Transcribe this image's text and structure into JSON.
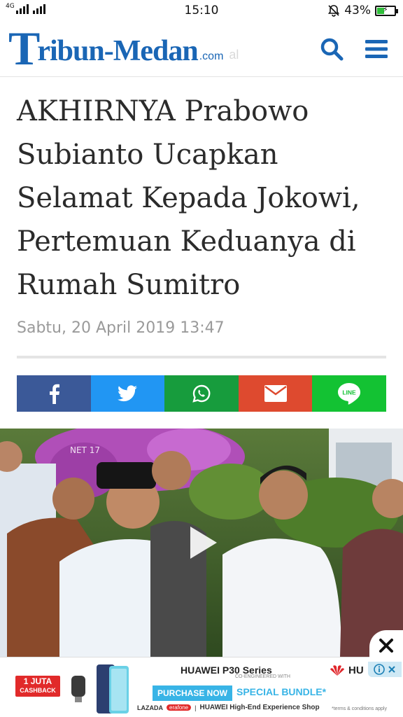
{
  "status_bar": {
    "network": "4G",
    "time": "15:10",
    "battery_percent": "43%",
    "battery_level": 0.43
  },
  "header": {
    "logo_initial": "T",
    "logo_name": "ribun-Medan",
    "logo_suffix": ".com",
    "logo_ghost_text": "al",
    "brand_color": "#1a66b5"
  },
  "article": {
    "headline": "AKHIRNYA Prabowo Subianto Ucapkan Selamat Kepada Jokowi, Pertemuan Keduanya di Rumah Sumitro",
    "date": "Sabtu, 20 April 2019 13:47"
  },
  "share_bar": {
    "buttons": [
      {
        "name": "facebook",
        "icon": "facebook-icon",
        "color": "#3b5998"
      },
      {
        "name": "twitter",
        "icon": "twitter-icon",
        "color": "#2196f3"
      },
      {
        "name": "whatsapp",
        "icon": "whatsapp-icon",
        "color": "#179c3d"
      },
      {
        "name": "email",
        "icon": "email-icon",
        "color": "#de4a2f"
      },
      {
        "name": "line",
        "icon": "line-icon",
        "color": "#13c233",
        "label": "LINE"
      }
    ]
  },
  "media": {
    "watermark": "NET 17",
    "icon": "play-icon"
  },
  "ad": {
    "badge_line1": "1 JUTA",
    "badge_line2": "CASHBACK",
    "title": "HUAWEI P30 Series",
    "title_sub": "CO-ENGINEERED WITH",
    "purchase_label": "PURCHASE NOW",
    "special_label": "SPECIAL BUNDLE*",
    "footer_lazada": "LAZADA",
    "footer_erafone": "erafone",
    "footer_shop": "HUAWEI High-End Experience Shop",
    "terms": "*terms & conditions apply",
    "brand_right": "HU",
    "close_icon": "close-icon"
  }
}
